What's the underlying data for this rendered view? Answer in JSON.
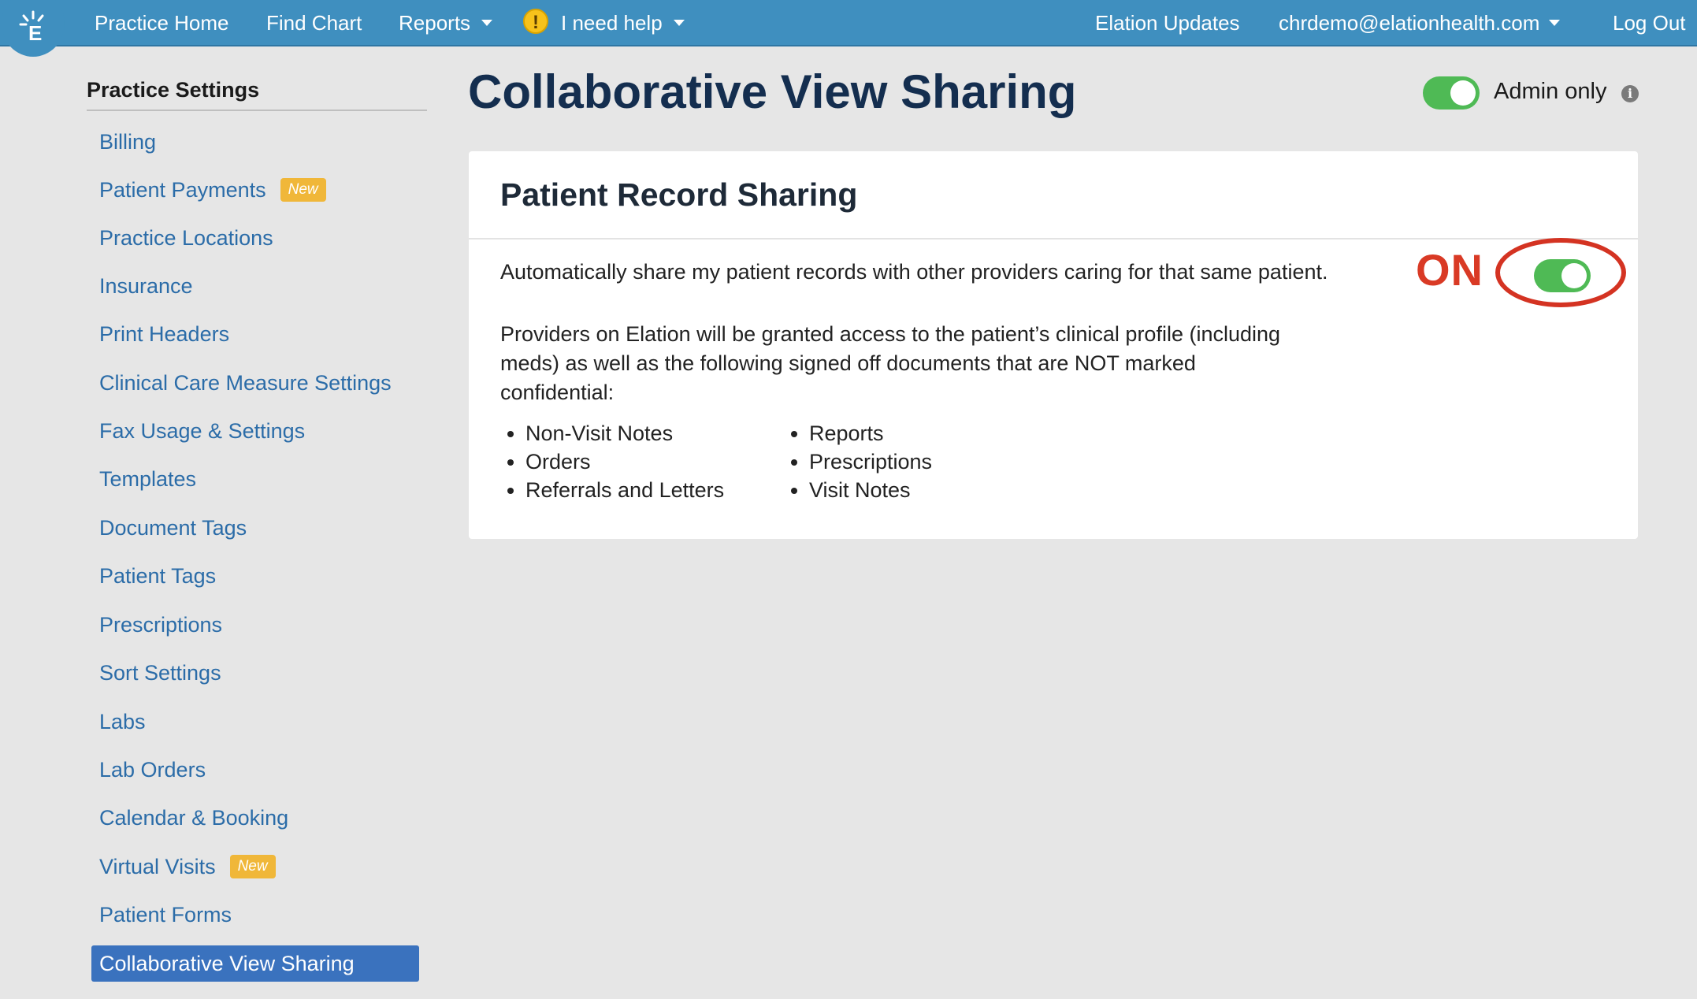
{
  "topbar": {
    "nav": [
      {
        "label": "Practice Home"
      },
      {
        "label": "Find Chart"
      },
      {
        "label": "Reports"
      },
      {
        "label": "I need help"
      }
    ],
    "updates": "Elation Updates",
    "user": "chrdemo@elationhealth.com",
    "logout": "Log Out"
  },
  "sidebar": {
    "title": "Practice Settings",
    "badge": "New",
    "items": [
      {
        "label": "Billing"
      },
      {
        "label": "Patient Payments",
        "badge": "New"
      },
      {
        "label": "Practice Locations"
      },
      {
        "label": "Insurance"
      },
      {
        "label": "Print Headers"
      },
      {
        "label": "Clinical Care Measure Settings"
      },
      {
        "label": "Fax Usage & Settings"
      },
      {
        "label": "Templates"
      },
      {
        "label": "Document Tags"
      },
      {
        "label": "Patient Tags"
      },
      {
        "label": "Prescriptions"
      },
      {
        "label": "Sort Settings"
      },
      {
        "label": "Labs"
      },
      {
        "label": "Lab Orders"
      },
      {
        "label": "Calendar & Booking"
      },
      {
        "label": "Virtual Visits",
        "badge": "New"
      },
      {
        "label": "Patient Forms"
      },
      {
        "label": "Collaborative View Sharing",
        "active": true
      }
    ]
  },
  "main": {
    "title": "Collaborative View Sharing",
    "admin_only_label": "Admin only",
    "admin_only_on": true,
    "card": {
      "title": "Patient Record Sharing",
      "share_text": "Automatically share my patient records with other providers caring for that same patient.",
      "annotation": "ON",
      "sharing_on": true,
      "description": "Providers on Elation will be granted access to the patient’s clinical profile (including meds) as well as the following signed off documents that are NOT marked confidential:",
      "documents_col1": [
        "Non-Visit Notes",
        "Orders",
        "Referrals and Letters"
      ],
      "documents_col2": [
        "Reports",
        "Prescriptions",
        "Visit Notes"
      ]
    }
  },
  "colors": {
    "topbar": "#3f8fbf",
    "link": "#2b6ca8",
    "active_bg": "#3a72be",
    "toggle_on": "#4fba55",
    "annotation": "#d93a25",
    "badge": "#f0b739"
  }
}
